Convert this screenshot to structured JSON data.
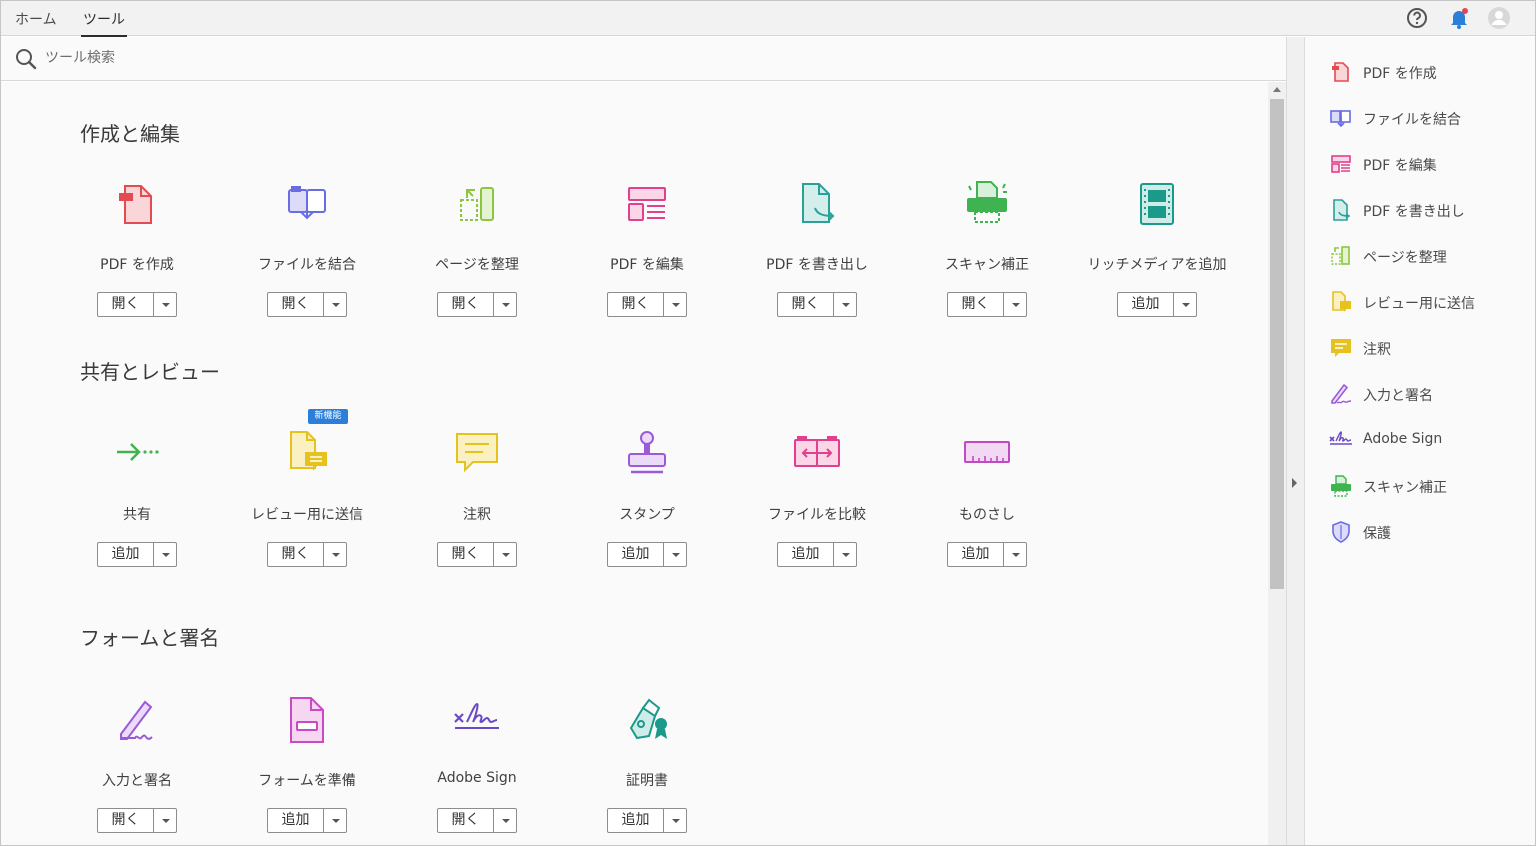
{
  "topbar": {
    "tab_home": "ホーム",
    "tab_tools": "ツール",
    "icons": [
      "help-icon",
      "bell-icon",
      "account-icon"
    ]
  },
  "search": {
    "placeholder": "ツール検索"
  },
  "sections": [
    {
      "title": "作成と編集",
      "tools": [
        {
          "name": "PDF を作成",
          "action": "開く",
          "icon": "create-pdf-icon",
          "color": "#e24b52"
        },
        {
          "name": "ファイルを結合",
          "action": "開く",
          "icon": "combine-files-icon",
          "color": "#6a6ce2"
        },
        {
          "name": "ページを整理",
          "action": "開く",
          "icon": "organize-pages-icon",
          "color": "#8cc63f"
        },
        {
          "name": "PDF を編集",
          "action": "開く",
          "icon": "edit-pdf-icon",
          "color": "#e0408c"
        },
        {
          "name": "PDF を書き出し",
          "action": "開く",
          "icon": "export-pdf-icon",
          "color": "#2aa198"
        },
        {
          "name": "スキャン補正",
          "action": "開く",
          "icon": "scan-icon",
          "color": "#3fb34f"
        },
        {
          "name": "リッチメディアを追加",
          "action": "追加",
          "icon": "rich-media-icon",
          "color": "#1a9a8a"
        }
      ]
    },
    {
      "title": "共有とレビュー",
      "tools": [
        {
          "name": "共有",
          "action": "追加",
          "icon": "share-icon",
          "color": "#3fb34f"
        },
        {
          "name": "レビュー用に送信",
          "action": "開く",
          "icon": "send-for-review-icon",
          "color": "#e6c21e",
          "badge": "新機能"
        },
        {
          "name": "注釈",
          "action": "開く",
          "icon": "comment-icon",
          "color": "#e6c21e"
        },
        {
          "name": "スタンプ",
          "action": "追加",
          "icon": "stamp-icon",
          "color": "#9c5ad6"
        },
        {
          "name": "ファイルを比較",
          "action": "追加",
          "icon": "compare-files-icon",
          "color": "#e0408c"
        },
        {
          "name": "ものさし",
          "action": "追加",
          "icon": "ruler-icon",
          "color": "#c04ac4"
        }
      ]
    },
    {
      "title": "フォームと署名",
      "tools": [
        {
          "name": "入力と署名",
          "action": "開く",
          "icon": "fill-sign-icon",
          "color": "#9c5ad6"
        },
        {
          "name": "フォームを準備",
          "action": "追加",
          "icon": "prepare-form-icon",
          "color": "#c84ac4"
        },
        {
          "name": "Adobe Sign",
          "action": "開く",
          "icon": "adobe-sign-icon",
          "color": "#6a4ac4"
        },
        {
          "name": "証明書",
          "action": "追加",
          "icon": "certificate-icon",
          "color": "#1a9a8a"
        }
      ]
    }
  ],
  "right_panel": [
    {
      "label": "PDF を作成",
      "icon": "create-pdf-icon",
      "color": "#e24b52"
    },
    {
      "label": "ファイルを結合",
      "icon": "combine-files-icon",
      "color": "#6a6ce2"
    },
    {
      "label": "PDF を編集",
      "icon": "edit-pdf-icon",
      "color": "#e0408c"
    },
    {
      "label": "PDF を書き出し",
      "icon": "export-pdf-icon",
      "color": "#2aa198"
    },
    {
      "label": "ページを整理",
      "icon": "organize-pages-icon",
      "color": "#8cc63f"
    },
    {
      "label": "レビュー用に送信",
      "icon": "send-for-review-icon",
      "color": "#e6c21e"
    },
    {
      "label": "注釈",
      "icon": "comment-icon",
      "color": "#e6c21e"
    },
    {
      "label": "入力と署名",
      "icon": "fill-sign-icon",
      "color": "#9c5ad6"
    },
    {
      "label": "Adobe Sign",
      "icon": "adobe-sign-icon",
      "color": "#6a4ac4"
    },
    {
      "label": "スキャン補正",
      "icon": "scan-icon",
      "color": "#3fb34f"
    },
    {
      "label": "保護",
      "icon": "protect-icon",
      "color": "#6a6ce2"
    }
  ]
}
